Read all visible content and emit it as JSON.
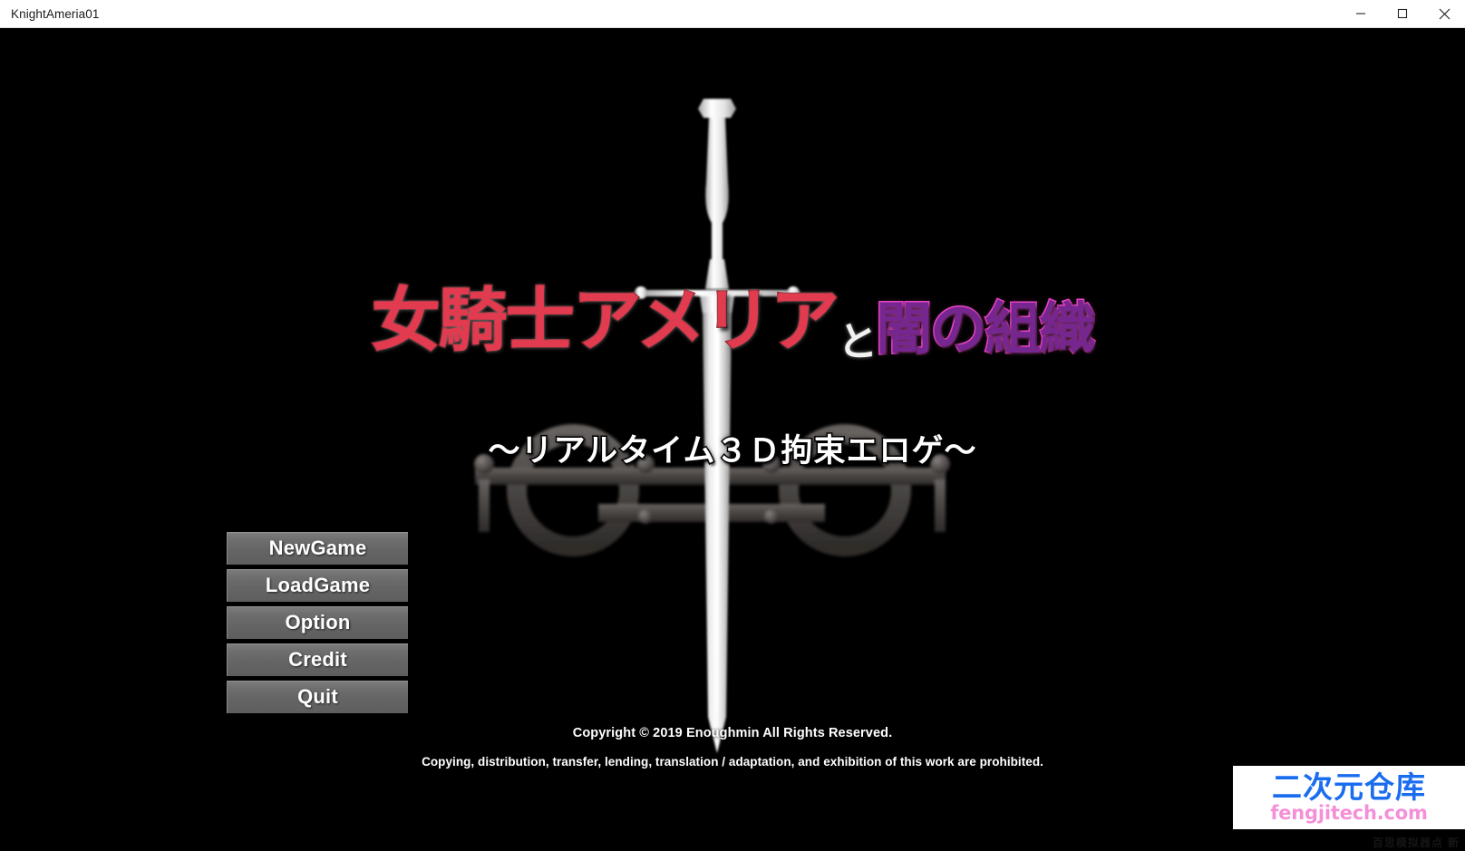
{
  "window": {
    "title": "KnightAmeria01",
    "controls": {
      "minimize": "minimize-button",
      "maximize": "maximize-button",
      "close": "close-button"
    }
  },
  "title_art": {
    "part_red": "女騎士アメリア",
    "part_white": "と",
    "part_purple": "闇の組織",
    "subtitle": "〜リアルタイム３Ｄ拘束エロゲ〜",
    "colors": {
      "red": "#e23a4e",
      "red_outline": "#8f1320",
      "white": "#f2f2f2",
      "purple": "#76268f",
      "purple_outline": "#e83ec4"
    }
  },
  "menu": {
    "items": [
      {
        "label": "NewGame"
      },
      {
        "label": "LoadGame"
      },
      {
        "label": "Option"
      },
      {
        "label": "Credit"
      },
      {
        "label": "Quit"
      }
    ]
  },
  "footer": {
    "copyright": "Copyright © 2019 Enoughmin All Rights Reserved.",
    "prohibition": "Copying, distribution, transfer, lending, translation / adaptation, and exhibition of this work are prohibited."
  },
  "watermark": {
    "name_cn": "二次元仓库",
    "url": "fengjitech.com",
    "fineprint": "百思模拟器点 新",
    "colors": {
      "name": "#1b6df0",
      "url": "#f48fd8",
      "background": "#ffffff"
    }
  }
}
